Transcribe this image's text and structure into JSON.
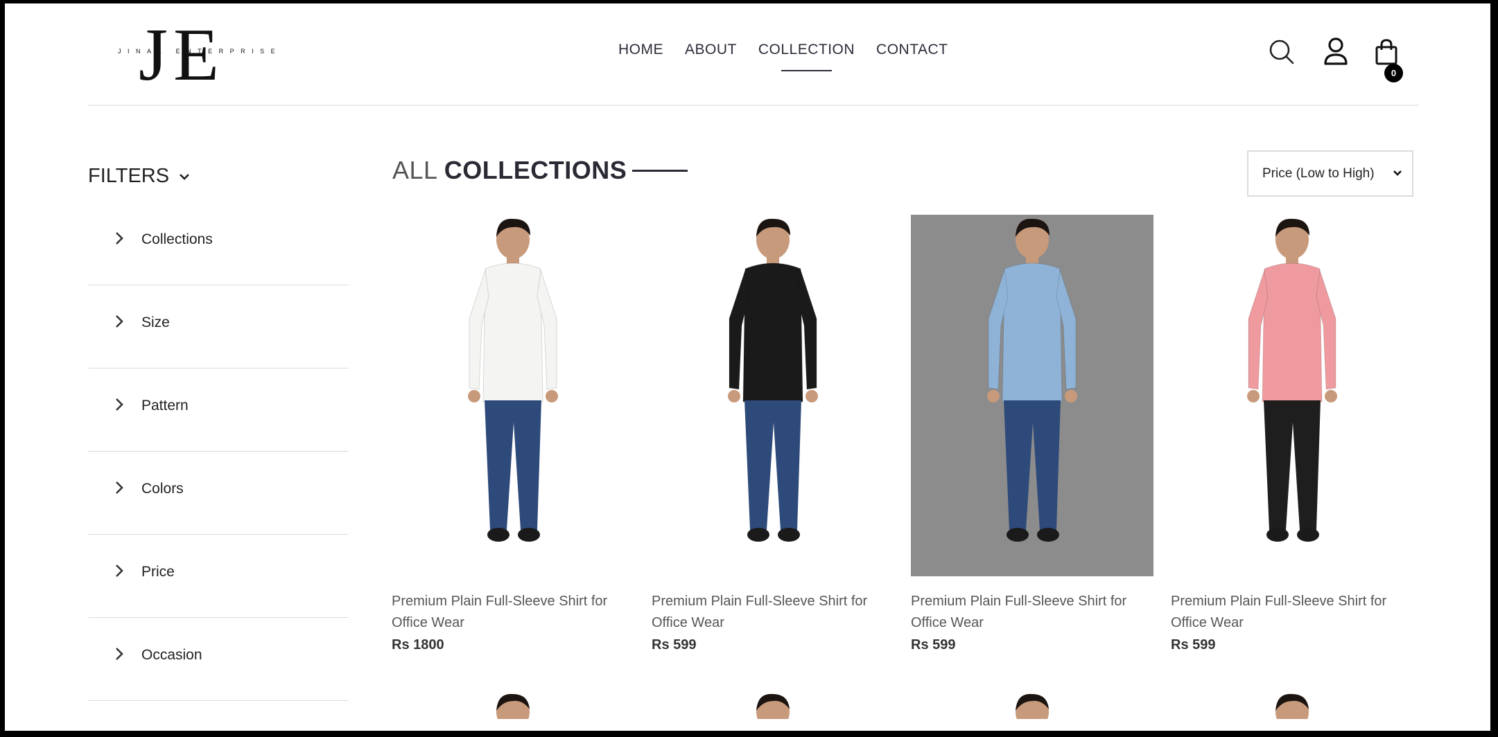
{
  "brand": {
    "logo_text": "JE",
    "logo_subtext": "JINAL ENTERPRISE"
  },
  "nav": {
    "items": [
      "HOME",
      "ABOUT",
      "COLLECTION",
      "CONTACT"
    ],
    "active": "COLLECTION"
  },
  "header_icons": [
    "search-icon",
    "user-icon",
    "shopping-bag-icon"
  ],
  "cart": {
    "count": "0"
  },
  "filters": {
    "title": "FILTERS",
    "items": [
      "Collections",
      "Size",
      "Pattern",
      "Colors",
      "Price",
      "Occasion"
    ]
  },
  "collection": {
    "title_light": "ALL",
    "title_bold": "COLLECTIONS",
    "sort_value": "Price (Low to High)"
  },
  "products": [
    {
      "name": "Premium Plain Full-Sleeve Shirt for Office Wear",
      "price": "Rs 1800",
      "shirt_color": "#f4f4f2",
      "bg": "#ffffff"
    },
    {
      "name": "Premium Plain Full-Sleeve Shirt for Office Wear",
      "price": "Rs 599",
      "shirt_color": "#1a1a1a",
      "bg": "#ffffff"
    },
    {
      "name": "Premium Plain Full-Sleeve Shirt for Office Wear",
      "price": "Rs 599",
      "shirt_color": "#8fb3d6",
      "bg": "#8c8c8c"
    },
    {
      "name": "Premium Plain Full-Sleeve Shirt for Office Wear",
      "price": "Rs 599",
      "shirt_color": "#ee9a9e",
      "bg": "#ffffff"
    }
  ],
  "colors": {
    "text_dark": "#2c2c3a",
    "divider": "#dcdcdc",
    "jeans": "#2e4a7a",
    "skin": "#c89a7c",
    "hair": "#1c1410"
  }
}
